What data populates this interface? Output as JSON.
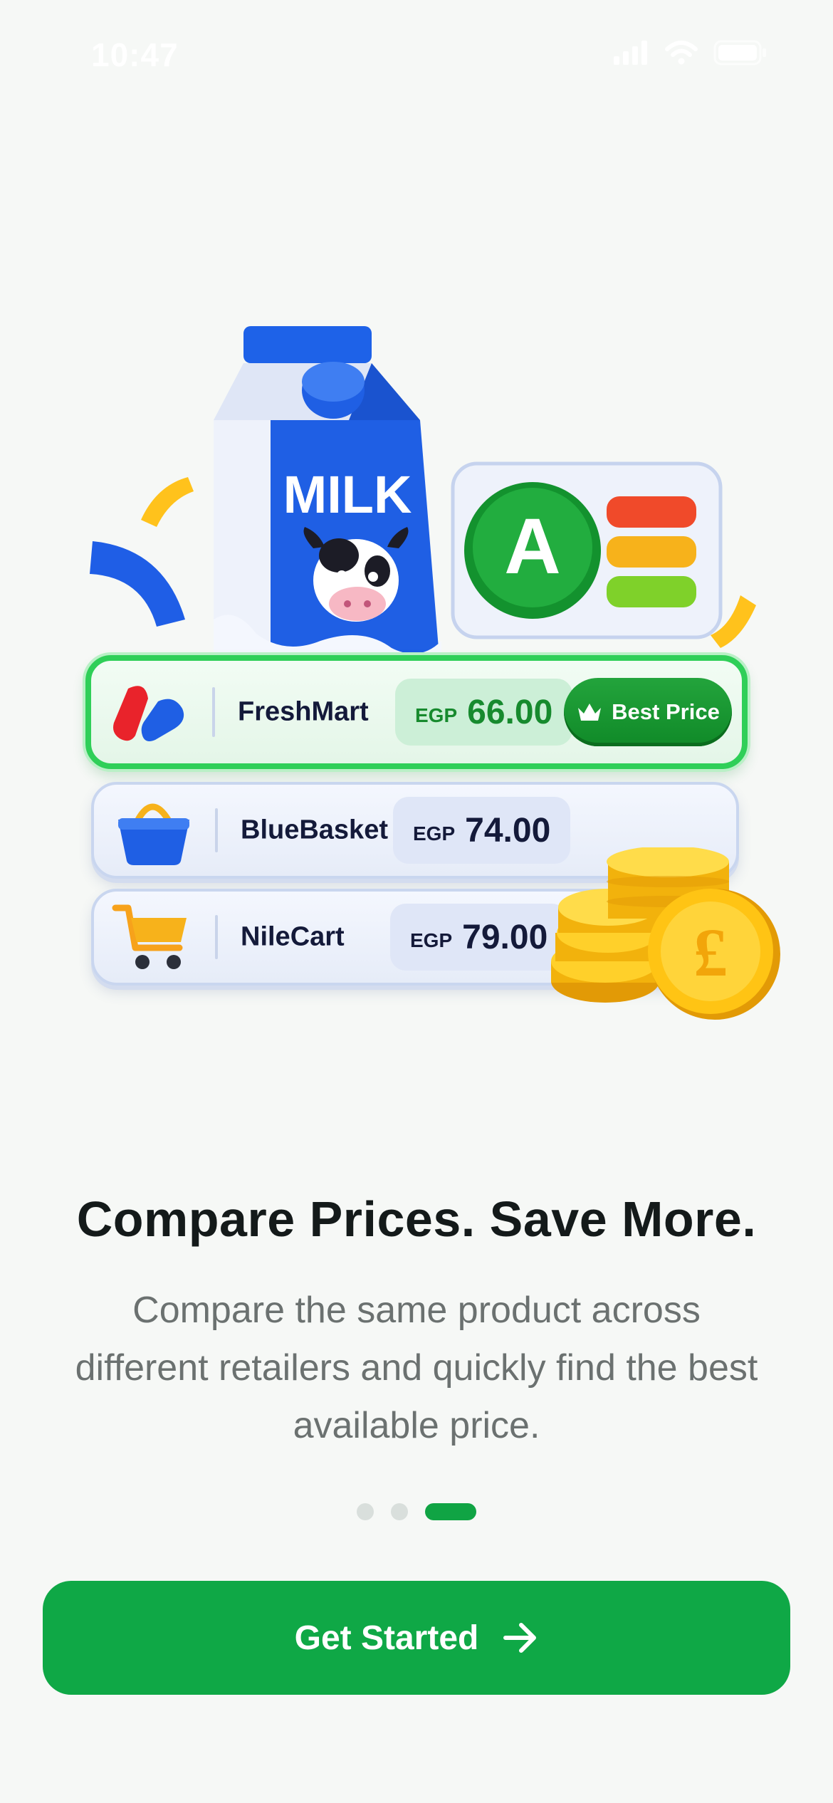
{
  "status_bar": {
    "time": "10:47"
  },
  "illustration": {
    "carton_label": "MILK",
    "grade_letter": "A",
    "retailers": [
      {
        "name": "FreshMart",
        "currency": "EGP",
        "price": "66.00",
        "best": true,
        "logo": "freshmart-logo-icon"
      },
      {
        "name": "BlueBasket",
        "currency": "EGP",
        "price": "74.00",
        "best": false,
        "logo": "basket-icon"
      },
      {
        "name": "NileCart",
        "currency": "EGP",
        "price": "79.00",
        "best": false,
        "logo": "cart-icon"
      }
    ],
    "best_badge": "Best Price",
    "coin_symbol": "£"
  },
  "onboarding": {
    "title": "Compare Prices. Save More.",
    "description": "Compare the same product across different retailers and quickly find the best available price.",
    "page_count": 3,
    "current_page": 3
  },
  "cta": {
    "label": "Get Started",
    "icon": "arrow-right-icon"
  },
  "colors": {
    "primary": "#0fa846",
    "background": "#f6f8f6",
    "title": "#141a1a",
    "body": "#6b7170"
  }
}
